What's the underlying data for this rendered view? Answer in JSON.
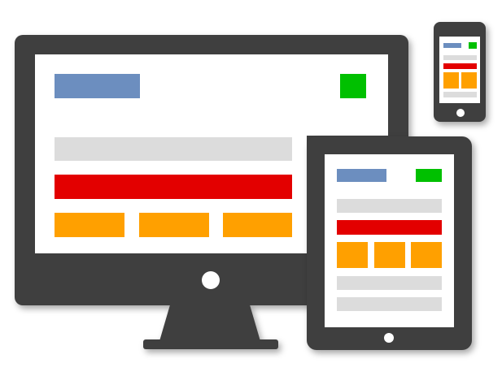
{
  "colors": {
    "device_body": "#3f3f3f",
    "screen_bg": "#ffffff",
    "logo_block": "#6c8ebf",
    "action_block": "#00c000",
    "nav_bar": "#dcdcdc",
    "hero_banner": "#e30000",
    "content_tile": "#ffa000",
    "camera_dot": "#ffffff"
  },
  "icons": {
    "desktop": "desktop-monitor-icon",
    "tablet": "tablet-icon",
    "phone": "smartphone-icon"
  },
  "layouts": {
    "desktop": {
      "tiles": 3,
      "bars_below_tiles": 0
    },
    "tablet": {
      "tiles": 3,
      "bars_below_tiles": 2
    },
    "phone": {
      "tiles": 2,
      "bars_below_tiles": 1
    }
  }
}
